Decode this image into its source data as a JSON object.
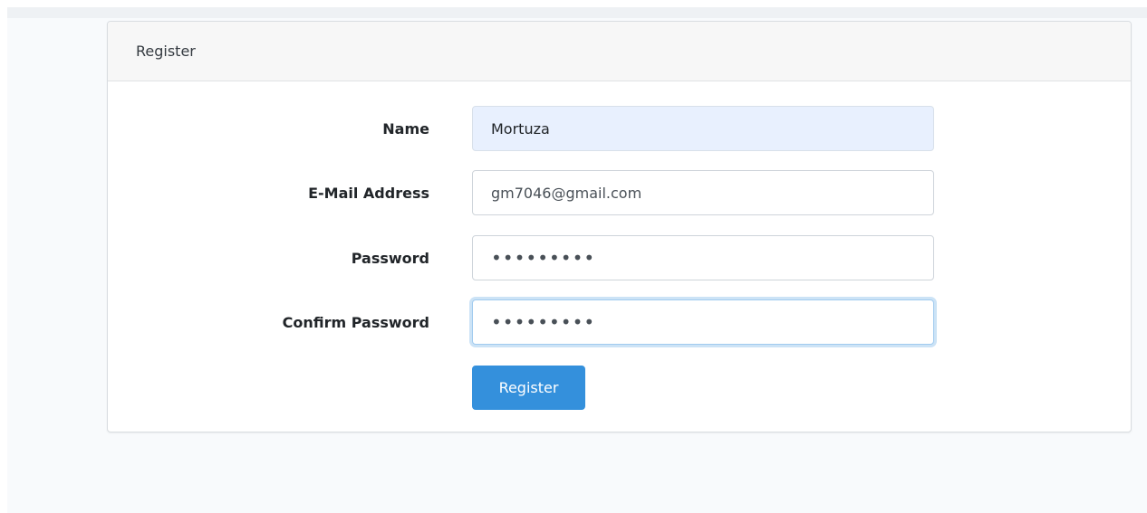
{
  "card": {
    "title": "Register"
  },
  "form": {
    "name": {
      "label": "Name",
      "value": "Mortuza"
    },
    "email": {
      "label": "E-Mail Address",
      "value": "gm7046@gmail.com"
    },
    "password": {
      "label": "Password",
      "value": "•••••••••"
    },
    "confirm_password": {
      "label": "Confirm Password",
      "value": "•••••••••"
    },
    "submit_label": "Register"
  },
  "colors": {
    "primary": "#3490dc",
    "autofill_bg": "#e8f0fe",
    "card_header_bg": "#f7f7f7"
  }
}
